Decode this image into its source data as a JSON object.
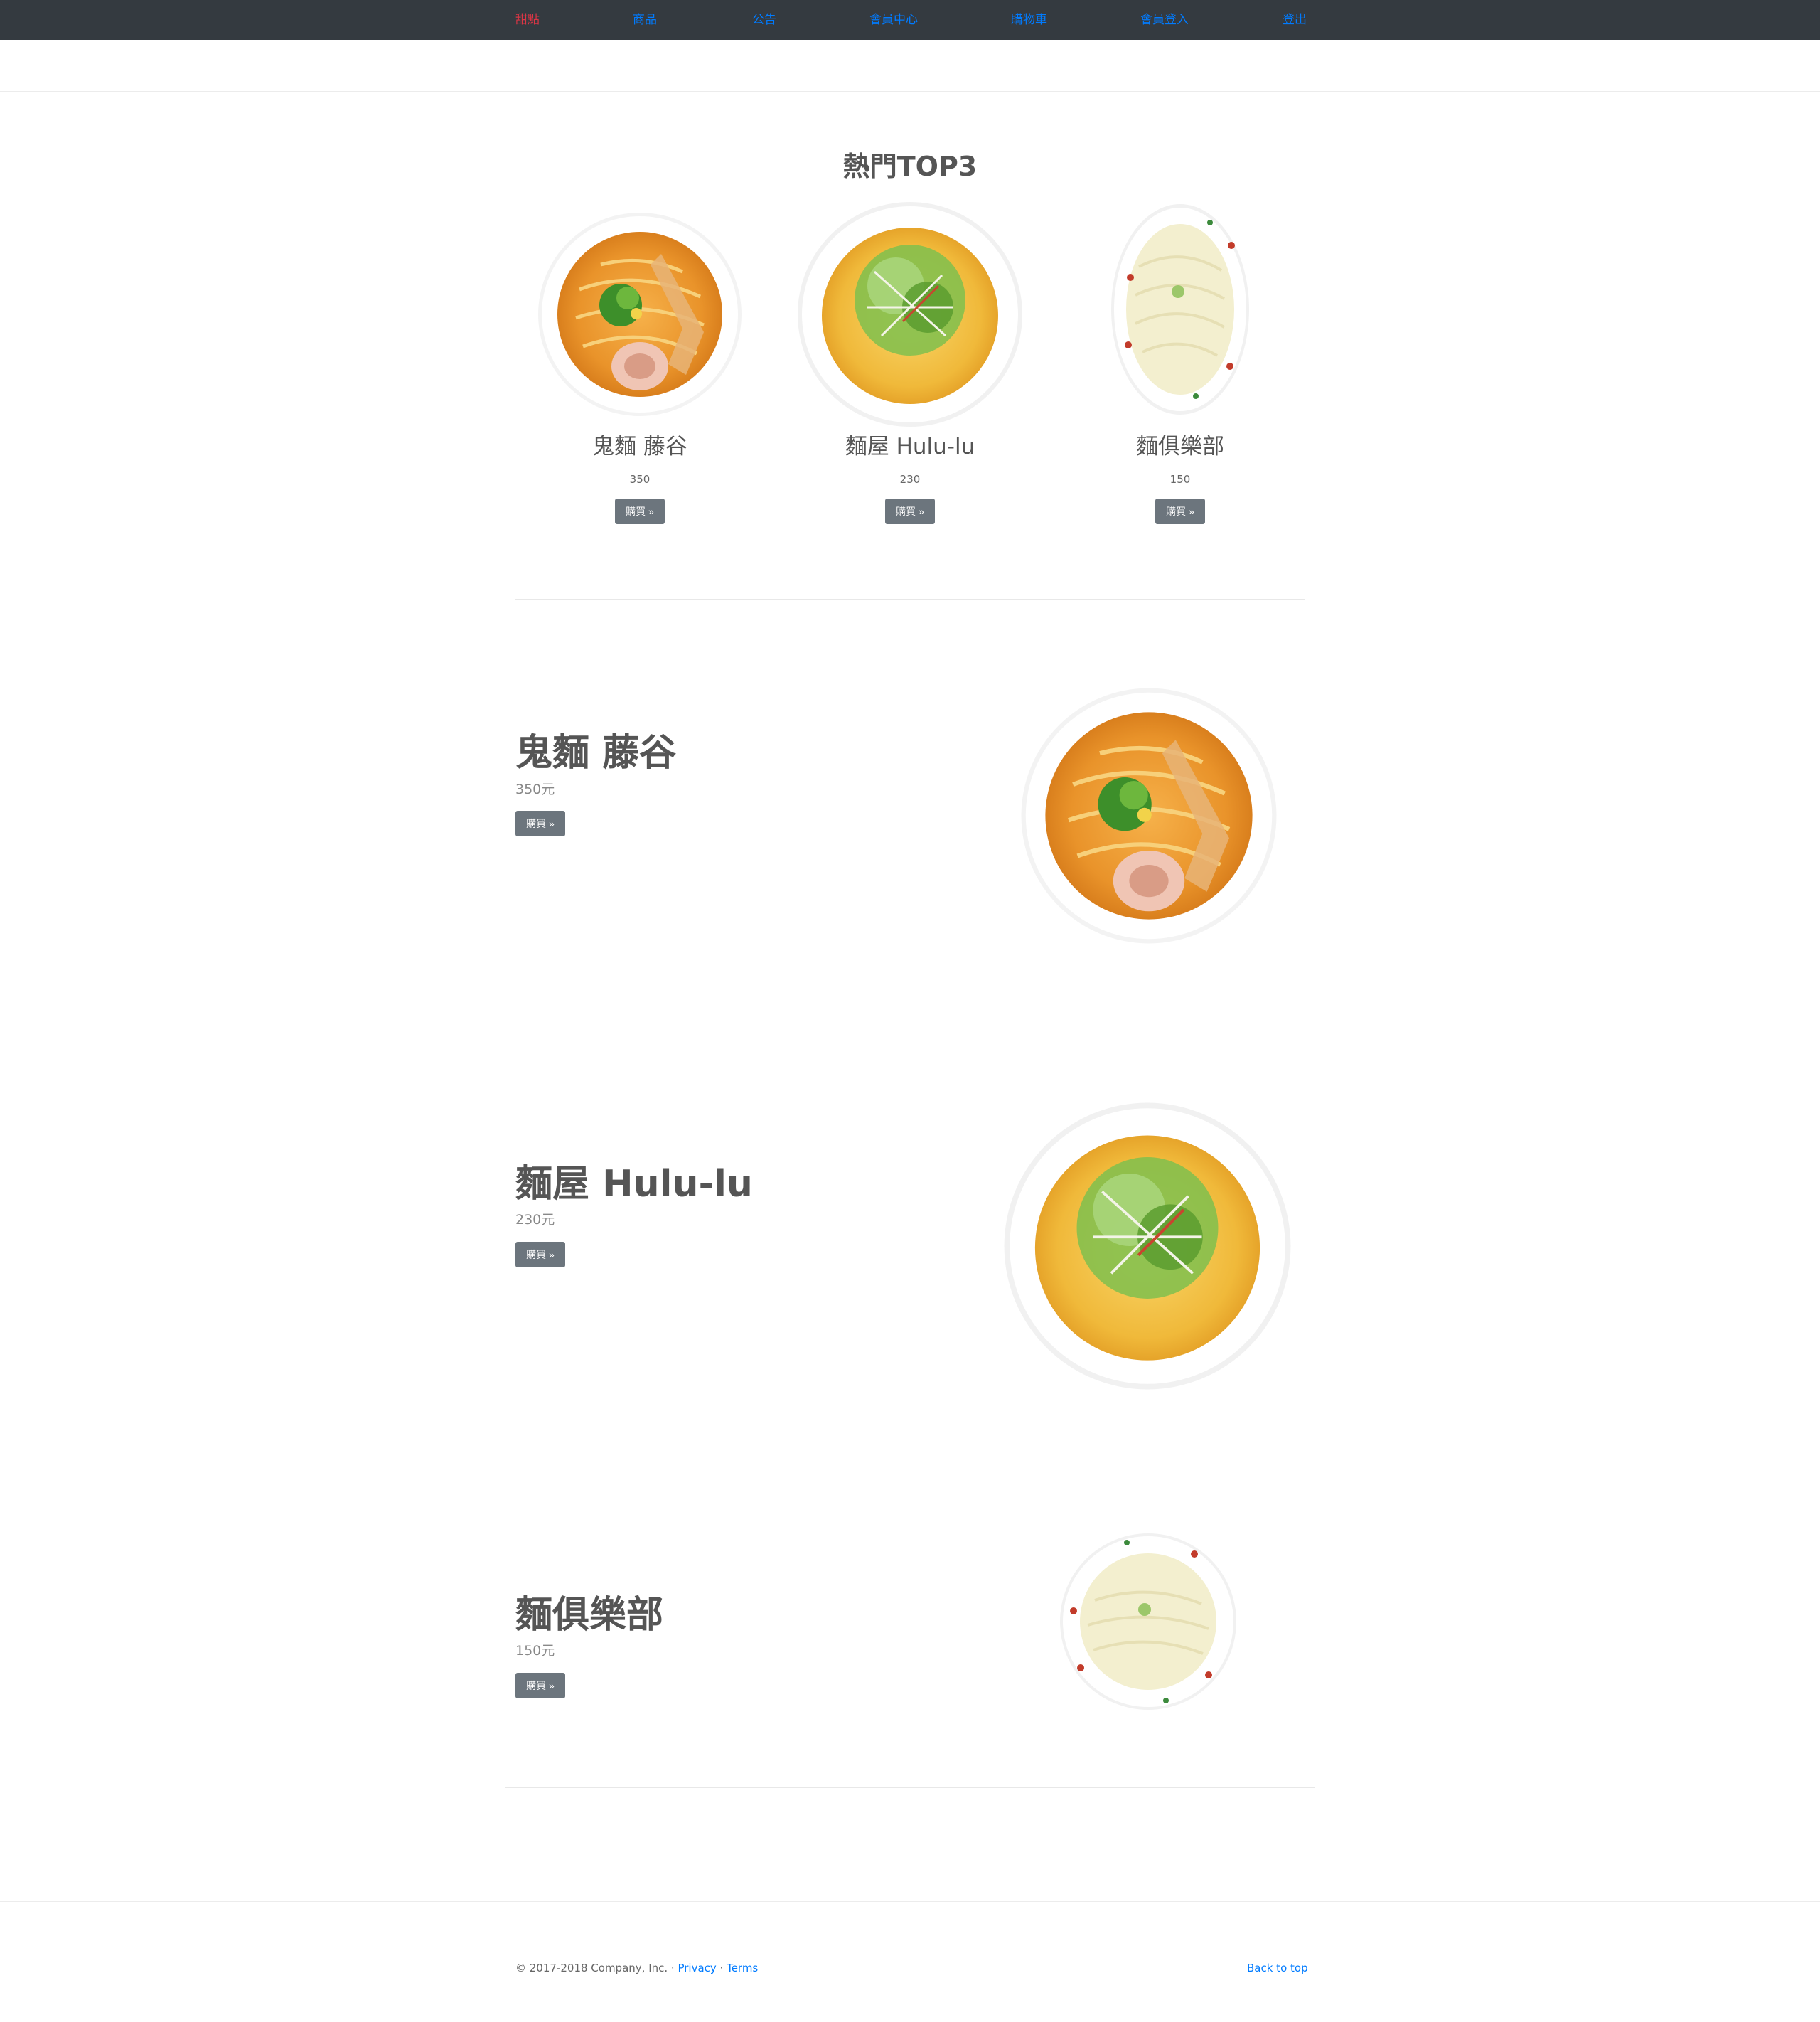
{
  "nav": {
    "items": [
      "甜點",
      "商品",
      "公告",
      "會員中心",
      "購物車",
      "會員登入",
      "登出"
    ],
    "active_color": "#dc3545",
    "link_color": "#007bff",
    "background": "#343a40"
  },
  "top3": {
    "title": "熱門TOP3",
    "items": [
      {
        "name": "鬼麵 藤谷",
        "price": "350",
        "button": "購買 »",
        "image": "ramen-bowl-shoyu"
      },
      {
        "name": "麵屋 Hulu-lu",
        "price": "230",
        "button": "購買 »",
        "image": "ramen-bowl-shio-greens"
      },
      {
        "name": "麵俱樂部",
        "price": "150",
        "button": "購買 »",
        "image": "ramen-bowl-white-broth"
      }
    ]
  },
  "featurettes": [
    {
      "title": "鬼麵 藤谷",
      "price": "350元",
      "button": "購買 »"
    },
    {
      "title": "麵屋 Hulu-lu",
      "price": "230元",
      "button": "購買 »"
    },
    {
      "title": "麵俱樂部",
      "price": "150元",
      "button": "購買 »"
    }
  ],
  "footer": {
    "copyright": "© 2017-2018 Company, Inc. · ",
    "privacy": "Privacy",
    "dot": " · ",
    "terms": "Terms",
    "back_to_top": "Back to top"
  },
  "colors": {
    "button": "#6c757d",
    "link": "#007bff"
  }
}
